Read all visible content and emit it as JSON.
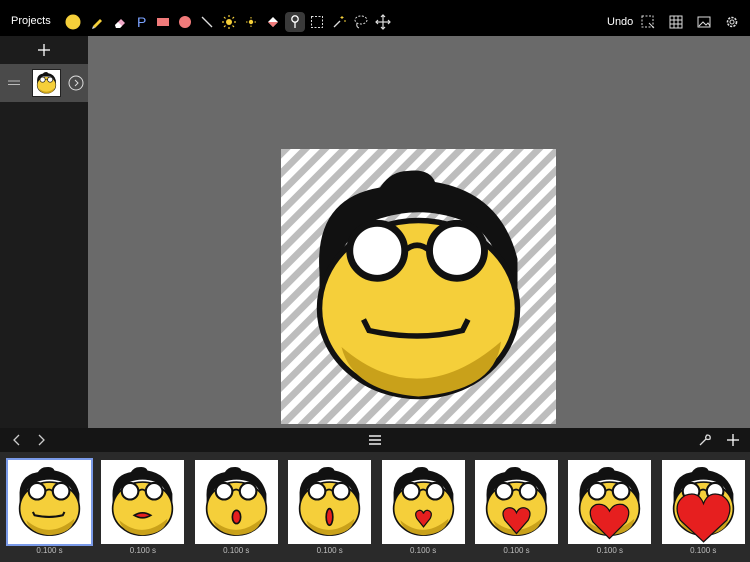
{
  "toolbar": {
    "projects_label": "Projects",
    "undo_label": "Undo",
    "current_color": "#f5cf3a",
    "tools": [
      "color-swatch",
      "pencil-icon",
      "eraser-icon",
      "text-tool-icon",
      "rectangle-icon",
      "ellipse-icon",
      "line-icon",
      "sun-icon",
      "small-sun-icon",
      "fill-bucket-icon",
      "eyedropper-icon",
      "rect-select-icon",
      "magic-wand-icon",
      "lasso-icon",
      "move-icon"
    ],
    "active_tool": "eyedropper-icon",
    "right_icons": [
      "selection-icon",
      "grid-icon",
      "image-icon",
      "settings-icon"
    ]
  },
  "layers": {
    "add_icon": "plus-icon",
    "items": [
      {
        "thumb": "smiley-glasses"
      }
    ]
  },
  "canvas": {
    "background": "transparency-stripes",
    "subject": "yellow pixel-art smiley with glasses and black hat"
  },
  "timeline": {
    "icons": [
      "chevron-left-icon",
      "chevron-right-icon",
      "menu-icon",
      "wrench-icon",
      "plus-icon"
    ]
  },
  "frames": [
    {
      "duration": "0.100 s",
      "variant": "smile"
    },
    {
      "duration": "0.100 s",
      "variant": "kiss-small"
    },
    {
      "duration": "0.100 s",
      "variant": "kiss"
    },
    {
      "duration": "0.100 s",
      "variant": "oval"
    },
    {
      "duration": "0.100 s",
      "variant": "heart-small"
    },
    {
      "duration": "0.100 s",
      "variant": "heart-medium"
    },
    {
      "duration": "0.100 s",
      "variant": "heart-large"
    },
    {
      "duration": "0.100 s",
      "variant": "heart-xl"
    }
  ],
  "colors": {
    "face_yellow": "#f5cf3a",
    "face_shade": "#c9a11a",
    "hat_black": "#111111",
    "heart_red": "#e61f1f",
    "selected_outline": "#7a9ae8"
  }
}
